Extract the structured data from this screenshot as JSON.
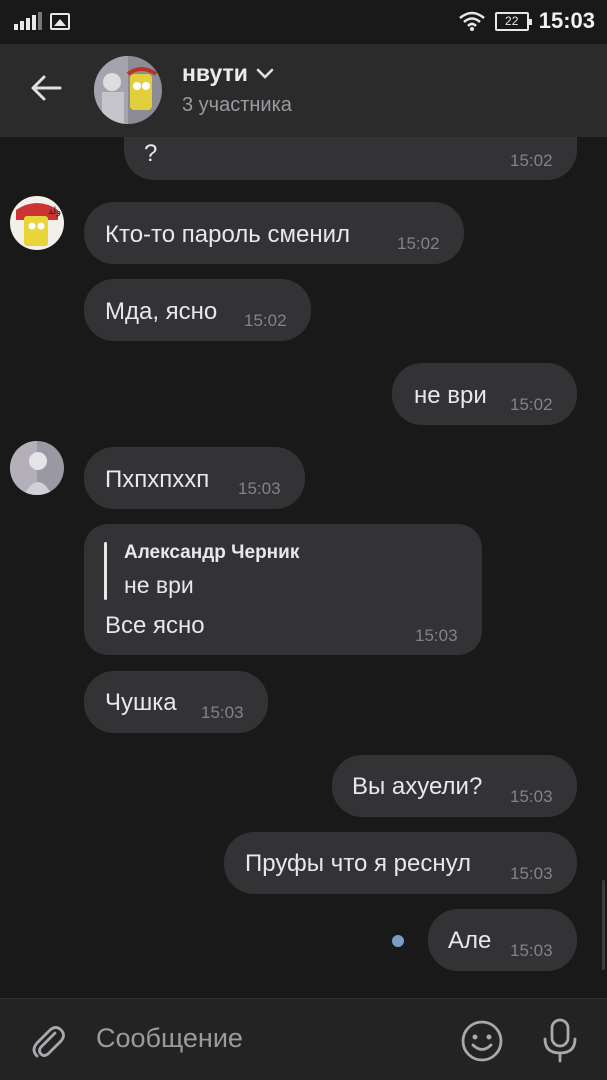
{
  "status_bar": {
    "battery": "22",
    "time": "15:03"
  },
  "header": {
    "title": "нвути",
    "subtitle": "3 участника"
  },
  "messages": [
    {
      "text": "?",
      "time": "15:02"
    },
    {
      "text": "Кто-то пароль сменил",
      "time": "15:02"
    },
    {
      "text": "Мда, ясно",
      "time": "15:02"
    },
    {
      "text": "не ври",
      "time": "15:02"
    },
    {
      "text": "Пхпхпххп",
      "time": "15:03"
    },
    {
      "reply_author": "Александр Черник",
      "reply_text": "не ври",
      "text": "Все ясно",
      "time": "15:03"
    },
    {
      "text": "Чушка",
      "time": "15:03"
    },
    {
      "text": "Вы ахуели?",
      "time": "15:03"
    },
    {
      "text": "Пруфы что я реснул",
      "time": "15:03"
    },
    {
      "text": "Але",
      "time": "15:03"
    }
  ],
  "composer": {
    "placeholder": "Сообщение"
  },
  "colors": {
    "background": "#19191a",
    "bubble": "#333335",
    "header": "#2b2b2c",
    "unread_dot": "#7a9cc6"
  },
  "icons": [
    "back-arrow-icon",
    "chevron-down-icon",
    "paperclip-icon",
    "emoji-icon",
    "microphone-icon",
    "signal-icon",
    "gallery-icon",
    "wifi-icon",
    "battery-icon"
  ]
}
